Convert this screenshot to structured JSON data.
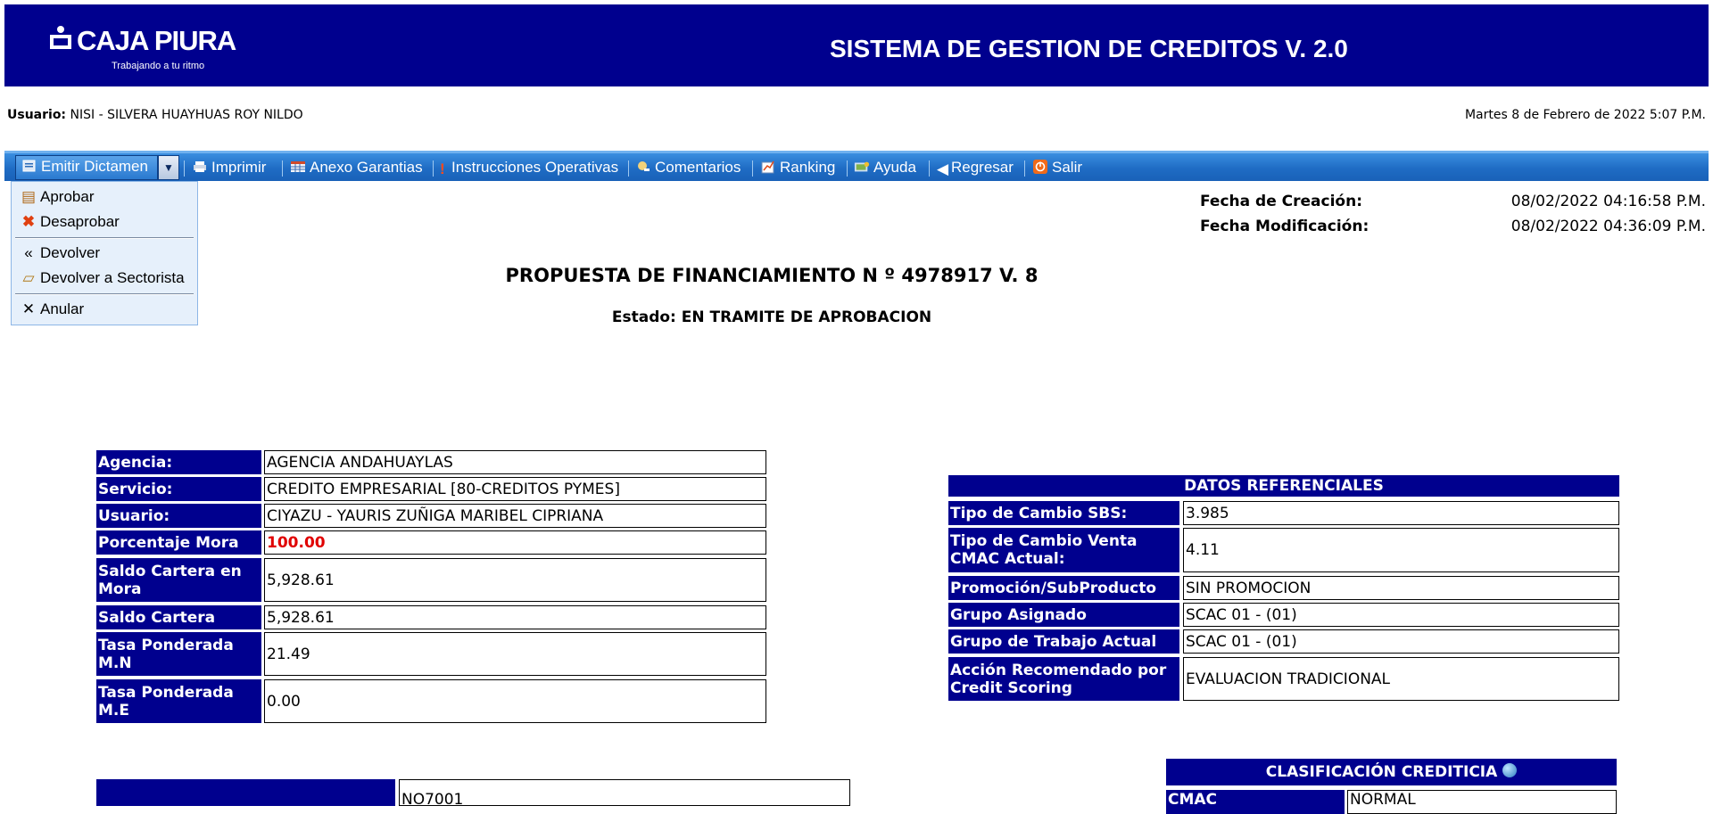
{
  "header": {
    "logo_text": "CAJA PIURA",
    "logo_tagline": "Trabajando a tu ritmo",
    "app_title": "SISTEMA DE GESTION DE CREDITOS V. 2.0"
  },
  "user_bar": {
    "user_label": "Usuario:",
    "user_value": "NISI - SILVERA HUAYHUAS ROY NILDO",
    "datetime": "Martes 8 de Febrero de 2022 5:07 P.M."
  },
  "menu": {
    "emitir": "Emitir Dictamen",
    "imprimir": "Imprimir",
    "anexo": "Anexo Garantias",
    "instrucciones": "Instrucciones Operativas",
    "comentarios": "Comentarios",
    "ranking": "Ranking",
    "ayuda": "Ayuda",
    "regresar": "Regresar",
    "salir": "Salir"
  },
  "dropdown": {
    "aprobar": "Aprobar",
    "desaprobar": "Desaprobar",
    "devolver": "Devolver",
    "devolver_sectorista": "Devolver a Sectorista",
    "anular": "Anular"
  },
  "meta": {
    "creacion_label": "Fecha de Creación:",
    "creacion_value": "08/02/2022 04:16:58 P.M.",
    "modificacion_label": "Fecha Modificación:",
    "modificacion_value": "08/02/2022 04:36:09 P.M."
  },
  "proposal": {
    "title": "PROPUESTA DE FINANCIAMIENTO N º 4978917 V. 8",
    "estado": "Estado: EN TRAMITE DE APROBACION"
  },
  "left_table": {
    "agencia_label": "Agencia:",
    "agencia_value": "AGENCIA ANDAHUAYLAS",
    "servicio_label": "Servicio:",
    "servicio_value": "CREDITO EMPRESARIAL [80-CREDITOS PYMES]",
    "usuario_label": "Usuario:",
    "usuario_value": "CIYAZU - YAURIS ZUÑIGA MARIBEL CIPRIANA",
    "mora_label": "Porcentaje Mora",
    "mora_value": "100.00",
    "saldo_mora_label": "Saldo Cartera en Mora",
    "saldo_mora_value": "5,928.61",
    "saldo_label": "Saldo Cartera",
    "saldo_value": "5,928.61",
    "tasa_mn_label": "Tasa Ponderada M.N",
    "tasa_mn_value": "21.49",
    "tasa_me_label": "Tasa Ponderada M.E",
    "tasa_me_value": "0.00"
  },
  "datos": {
    "title": "DATOS REFERENCIALES",
    "tc_sbs_label": "Tipo de Cambio SBS:",
    "tc_sbs_value": "3.985",
    "tc_venta_label": "Tipo de Cambio Venta CMAC Actual:",
    "tc_venta_value": "4.11",
    "promo_label": "Promoción/SubProducto",
    "promo_value": "SIN PROMOCION",
    "grupo_label": "Grupo Asignado",
    "grupo_value": "SCAC 01 - (01)",
    "grupo_trab_label": "Grupo de Trabajo Actual",
    "grupo_trab_value": "SCAC 01 - (01)",
    "accion_label": "Acción Recomendado por Credit Scoring",
    "accion_value": "EVALUACION TRADICIONAL"
  },
  "clasificacion": {
    "title": "CLASIFICACIÓN CREDITICIA",
    "cmac_label": "CMAC",
    "cmac_value": "NORMAL",
    "bottom_value": "NO7001"
  }
}
